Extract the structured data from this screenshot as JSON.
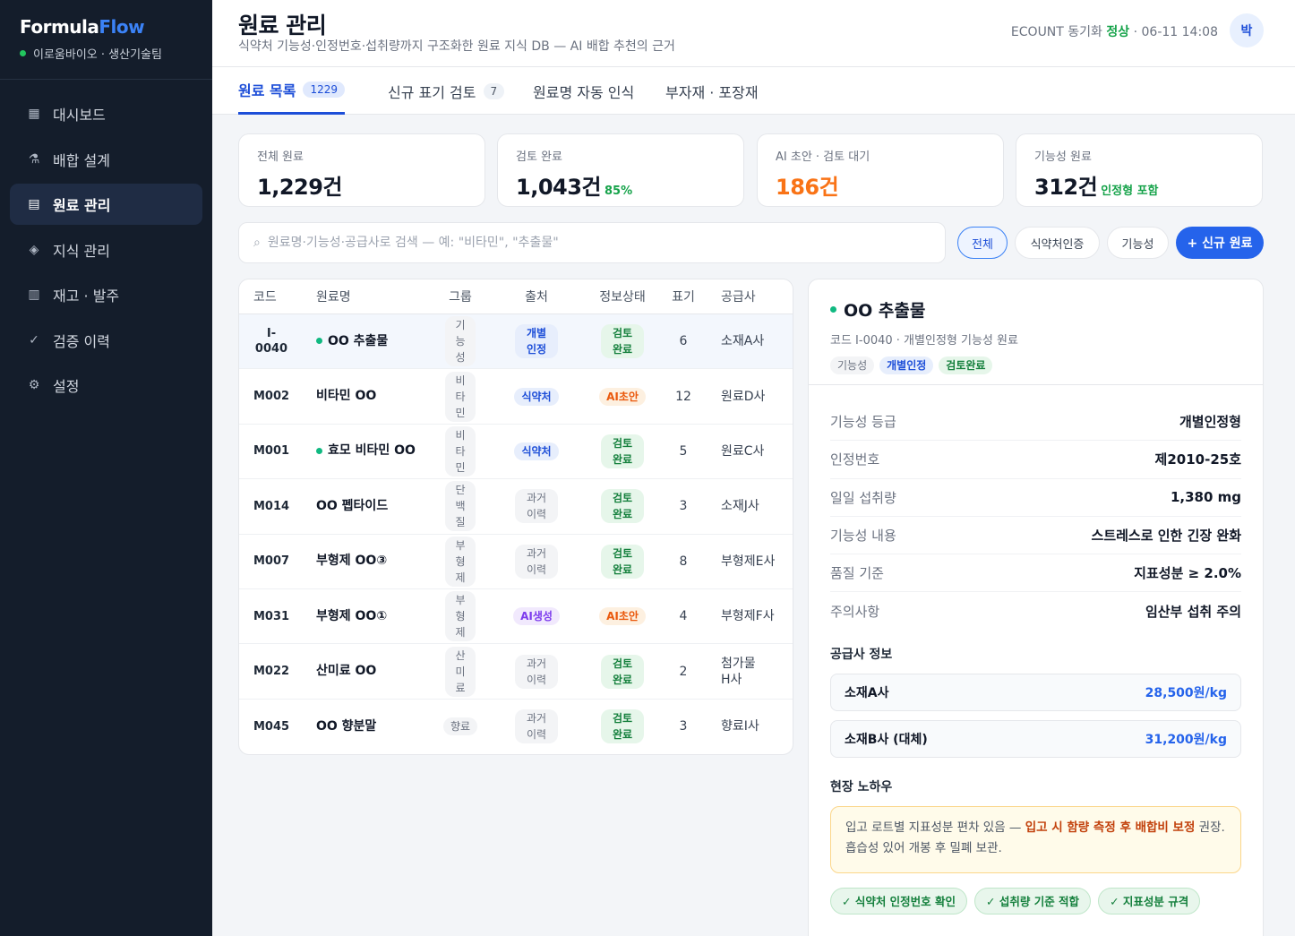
{
  "brand": {
    "name_part1": "Formula",
    "name_part2": "Flow",
    "org": "이로움바이오 · 생산기술팀"
  },
  "nav": [
    {
      "icon": "grid-icon",
      "glyph": "▦",
      "label": "대시보드"
    },
    {
      "icon": "flask-icon",
      "glyph": "⚗",
      "label": "배합 설계"
    },
    {
      "icon": "list-icon",
      "glyph": "▤",
      "label": "원료 관리"
    },
    {
      "icon": "diamond-icon",
      "glyph": "◈",
      "label": "지식 관리"
    },
    {
      "icon": "inventory-icon",
      "glyph": "▥",
      "label": "재고 · 발주"
    },
    {
      "icon": "check-icon",
      "glyph": "✓",
      "label": "검증 이력"
    },
    {
      "icon": "gear-icon",
      "glyph": "⚙",
      "label": "설정"
    }
  ],
  "header": {
    "title": "원료 관리",
    "subtitle": "식약처 기능성·인정번호·섭취량까지 구조화한 원료 지식 DB — AI 배합 추천의 근거",
    "sync_prefix": "ECOUNT 동기화",
    "sync_status": "정상",
    "sync_time": "· 06-11 14:08",
    "avatar": "박"
  },
  "tabs": [
    {
      "label": "원료 목록",
      "count": "1229"
    },
    {
      "label": "신규 표기 검토",
      "count": "7"
    },
    {
      "label": "원료명 자동 인식",
      "count": ""
    },
    {
      "label": "부자재 · 포장재",
      "count": ""
    }
  ],
  "stats": [
    {
      "label": "전체 원료",
      "value": "1,229건",
      "extra": ""
    },
    {
      "label": "검토 완료",
      "value": "1,043건",
      "extra": "85%"
    },
    {
      "label": "AI 초안 · 검토 대기",
      "value": "186건",
      "extra": ""
    },
    {
      "label": "기능성 원료",
      "value": "312건",
      "extra": "인정형 포함"
    }
  ],
  "search": {
    "icon": "⌕",
    "placeholder": "원료명·기능성·공급사로 검색 — 예: \"비타민\", \"추출물\""
  },
  "filters": [
    "전체",
    "식약처인증",
    "기능성"
  ],
  "new_button": "+ 신규 원료",
  "table": {
    "headers": [
      "코드",
      "원료명",
      "그룹",
      "출처",
      "정보상태",
      "표기",
      "공급사"
    ],
    "rows": [
      {
        "code": "I-0040",
        "name": "OO 추출물",
        "dot": true,
        "group": "기능성",
        "source": "개별인정",
        "status": "검토완료",
        "labels": "6",
        "supplier": "소재A사"
      },
      {
        "code": "M002",
        "name": "비타민 OO",
        "dot": false,
        "group": "비타민",
        "source": "식약처",
        "status": "AI초안",
        "labels": "12",
        "supplier": "원료D사"
      },
      {
        "code": "M001",
        "name": "효모 비타민 OO",
        "dot": true,
        "group": "비타민",
        "source": "식약처",
        "status": "검토완료",
        "labels": "5",
        "supplier": "원료C사"
      },
      {
        "code": "M014",
        "name": "OO 펩타이드",
        "dot": false,
        "group": "단백질",
        "source": "과거이력",
        "status": "검토완료",
        "labels": "3",
        "supplier": "소재J사"
      },
      {
        "code": "M007",
        "name": "부형제 OO③",
        "dot": false,
        "group": "부형제",
        "source": "과거이력",
        "status": "검토완료",
        "labels": "8",
        "supplier": "부형제E사"
      },
      {
        "code": "M031",
        "name": "부형제 OO①",
        "dot": false,
        "group": "부형제",
        "source": "AI생성",
        "status": "AI초안",
        "labels": "4",
        "supplier": "부형제F사"
      },
      {
        "code": "M022",
        "name": "산미료 OO",
        "dot": false,
        "group": "산미료",
        "source": "과거이력",
        "status": "검토완료",
        "labels": "2",
        "supplier": "첨가물H사"
      },
      {
        "code": "M045",
        "name": "OO 향분말",
        "dot": false,
        "group": "향료",
        "source": "과거이력",
        "status": "검토완료",
        "labels": "3",
        "supplier": "향료I사"
      }
    ]
  },
  "detail": {
    "title": "OO 추출물",
    "meta": "코드 I-0040 · 개별인정형 기능성 원료",
    "tags": [
      "기능성",
      "개별인정",
      "검토완료"
    ],
    "fields": [
      {
        "k": "기능성 등급",
        "v": "개별인정형"
      },
      {
        "k": "인정번호",
        "v": "제2010-25호"
      },
      {
        "k": "일일 섭취량",
        "v": "1,380 mg"
      },
      {
        "k": "기능성 내용",
        "v": "스트레스로 인한 긴장 완화"
      },
      {
        "k": "품질 기준",
        "v": "지표성분 ≥ 2.0%"
      },
      {
        "k": "주의사항",
        "v": "임산부 섭취 주의"
      }
    ],
    "supplier_title": "공급사 정보",
    "suppliers": [
      {
        "name": "소재A사",
        "price": "28,500원/kg"
      },
      {
        "name": "소재B사 (대체)",
        "price": "31,200원/kg"
      }
    ],
    "knowhow_title": "현장 노하우",
    "knowhow_pre": "입고 로트별 지표성분 편차 있음 — ",
    "knowhow_bold": "입고 시 함량 측정 후 배합비 보정",
    "knowhow_post": " 권장. 흡습성 있어 개봉 후 밀폐 보관.",
    "checks": [
      "✓ 식약처 인정번호 확인",
      "✓ 섭취량 기준 적합",
      "✓ 지표성분 규격"
    ]
  }
}
